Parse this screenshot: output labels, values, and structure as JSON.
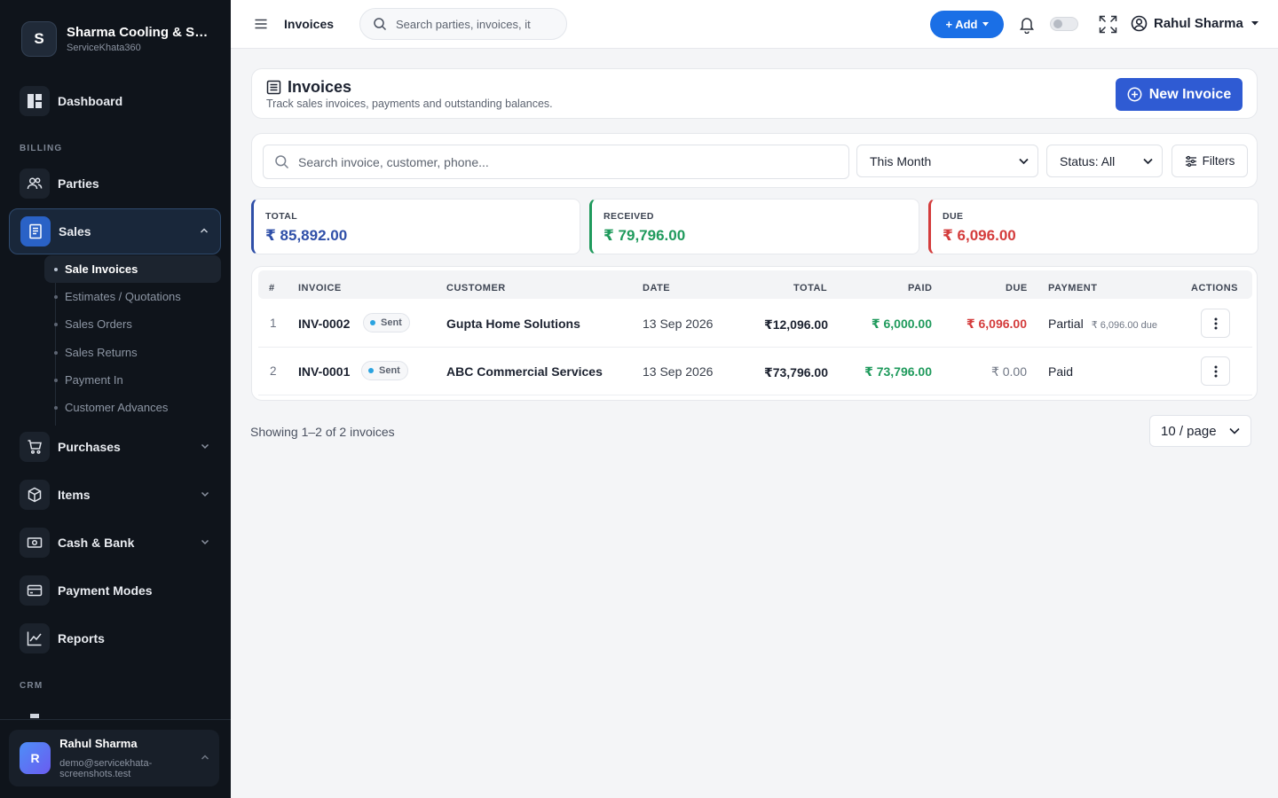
{
  "brand": {
    "initial": "S",
    "name": "Sharma Cooling & Services",
    "subtitle": "ServiceKhata360"
  },
  "sidebar": {
    "dashboard": "Dashboard",
    "billing_label": "BILLING",
    "parties": "Parties",
    "sales": "Sales",
    "sales_sub": [
      "Sale Invoices",
      "Estimates / Quotations",
      "Sales Orders",
      "Sales Returns",
      "Payment In",
      "Customer Advances"
    ],
    "purchases": "Purchases",
    "items": "Items",
    "cash_bank": "Cash & Bank",
    "payment_modes": "Payment Modes",
    "reports": "Reports",
    "crm_label": "CRM",
    "user": {
      "initial": "R",
      "name": "Rahul Sharma",
      "email": "demo@servicekhata-screenshots.test"
    }
  },
  "topbar": {
    "title": "Invoices",
    "search_placeholder": "Search parties, invoices, it",
    "add_label": "+ Add",
    "user_name": "Rahul Sharma"
  },
  "page": {
    "title": "Invoices",
    "subtitle": "Track sales invoices, payments and outstanding balances.",
    "new_invoice": "New Invoice"
  },
  "filters": {
    "search_placeholder": "Search invoice, customer, phone...",
    "period": "This Month",
    "status": "Status: All",
    "filters_label": "Filters"
  },
  "stats": {
    "total": {
      "label": "TOTAL",
      "value": "₹ 85,892.00",
      "color": "#2f4fa8"
    },
    "received": {
      "label": "RECEIVED",
      "value": "₹ 79,796.00",
      "color": "#1f9a5c"
    },
    "due": {
      "label": "DUE",
      "value": "₹ 6,096.00",
      "color": "#d43c3c"
    }
  },
  "table": {
    "columns": [
      "#",
      "INVOICE",
      "CUSTOMER",
      "DATE",
      "TOTAL",
      "PAID",
      "DUE",
      "PAYMENT",
      "ACTIONS"
    ],
    "rows": [
      {
        "num": "1",
        "invoice": "INV-0002",
        "status": "Sent",
        "customer": "Gupta Home Solutions",
        "date": "13 Sep 2026",
        "total": "₹12,096.00",
        "paid": "₹ 6,000.00",
        "due": "₹ 6,096.00",
        "payment": "Partial",
        "due_note": "₹ 6,096.00 due"
      },
      {
        "num": "2",
        "invoice": "INV-0001",
        "status": "Sent",
        "customer": "ABC Commercial Services",
        "date": "13 Sep 2026",
        "total": "₹73,796.00",
        "paid": "₹ 73,796.00",
        "due": "₹ 0.00",
        "payment": "Paid",
        "due_note": ""
      }
    ]
  },
  "footer": {
    "showing": "Showing 1–2 of 2 invoices",
    "per_page": "10 / page"
  }
}
